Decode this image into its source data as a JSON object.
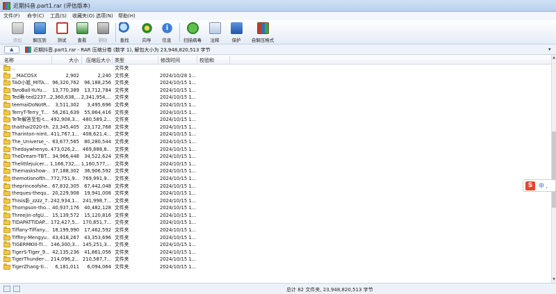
{
  "window": {
    "title": "近期抖音.part1.rar (评估版本)"
  },
  "menu": [
    "文件(F)",
    "命令(C)",
    "工具(S)",
    "收藏夹(O)",
    "选项(N)",
    "帮助(H)"
  ],
  "toolbar": [
    {
      "label": "添加",
      "icon": "add-files-icon",
      "dim": true
    },
    {
      "label": "解压到",
      "icon": "extract-folder-icon"
    },
    {
      "label": "测试",
      "icon": "test-checklist-icon"
    },
    {
      "label": "查看",
      "icon": "view-book-icon"
    },
    {
      "label": "删除",
      "icon": "trash-icon",
      "dim": true
    },
    {
      "label": "查找",
      "icon": "magnifier-icon"
    },
    {
      "label": "向导",
      "icon": "wizard-icon"
    },
    {
      "label": "信息",
      "icon": "info-icon"
    },
    {
      "label": "扫描病毒",
      "icon": "virus-scan-icon"
    },
    {
      "label": "注释",
      "icon": "comment-icon"
    },
    {
      "label": "保护",
      "icon": "shield-icon"
    },
    {
      "label": "自解压格式",
      "icon": "sfx-icon"
    }
  ],
  "address": {
    "path": "近期抖音.part1.rar - RAR 压缩分卷 (数字 1), 解包大小为 23,948,820,513 字节"
  },
  "columns": [
    "名称",
    "大小",
    "压缩后大小",
    "类型",
    "修改时间",
    "校验和"
  ],
  "rows": [
    {
      "name": "..",
      "size": "",
      "packed": "",
      "type": "文件夹",
      "modified": ""
    },
    {
      "name": "__MACOSX",
      "size": "2,902",
      "packed": "2,240",
      "type": "文件夹",
      "modified": "2024/10/28 1..."
    },
    {
      "name": "TAO小姐_MITA...",
      "size": "96,320,762",
      "packed": "96,188,256",
      "type": "文件夹",
      "modified": "2024/10/15 1..."
    },
    {
      "name": "TaroBall-YuYu...",
      "size": "13,770,389",
      "packed": "13,712,784",
      "type": "文件夹",
      "modified": "2024/10/15 1..."
    },
    {
      "name": "Ted啾-ted2237...",
      "size": "2,360,638,...",
      "packed": "2,341,954,...",
      "type": "文件夹",
      "modified": "2024/10/15 1..."
    },
    {
      "name": "teemaiDoNotR...",
      "size": "3,511,302",
      "packed": "3,495,696",
      "type": "文件夹",
      "modified": "2024/10/15 1..."
    },
    {
      "name": "TerryT-Terry_T...",
      "size": "56,261,639",
      "packed": "55,864,416",
      "type": "文件夹",
      "modified": "2024/10/15 1..."
    },
    {
      "name": "TeTe解答至包-t...",
      "size": "492,908,3...",
      "packed": "480,589,2...",
      "type": "文件夹",
      "modified": "2024/10/15 1..."
    },
    {
      "name": "thaithai2020-th...",
      "size": "23,345,405",
      "packed": "23,172,768",
      "type": "文件夹",
      "modified": "2024/10/15 1..."
    },
    {
      "name": "Tharinton-nimt...",
      "size": "411,767,1...",
      "packed": "408,621,4...",
      "type": "文件夹",
      "modified": "2024/10/15 1..."
    },
    {
      "name": "The_Universe_-...",
      "size": "83,677,565",
      "packed": "80,280,544",
      "type": "文件夹",
      "modified": "2024/10/15 1..."
    },
    {
      "name": "Thedaywhenyo...",
      "size": "473,026,2...",
      "packed": "469,888,8...",
      "type": "文件夹",
      "modified": "2024/10/15 1..."
    },
    {
      "name": "TheDream-TBT...",
      "size": "34,966,448",
      "packed": "34,522,624",
      "type": "文件夹",
      "modified": "2024/10/15 1..."
    },
    {
      "name": "Thelittlejuicer...",
      "size": "1,166,732,...",
      "packed": "1,160,577,...",
      "type": "文件夹",
      "modified": "2024/10/15 1..."
    },
    {
      "name": "Themaskshow-...",
      "size": "37,188,302",
      "packed": "36,906,592",
      "type": "文件夹",
      "modified": "2024/10/15 1..."
    },
    {
      "name": "themotionofth...",
      "size": "772,751,9...",
      "packed": "769,991,9...",
      "type": "文件夹",
      "modified": "2024/10/15 1..."
    },
    {
      "name": "theprinceofshe...",
      "size": "67,832,305",
      "packed": "67,442,048",
      "type": "文件夹",
      "modified": "2024/10/15 1..."
    },
    {
      "name": "theques-thequ...",
      "size": "20,229,908",
      "packed": "19,941,008",
      "type": "文件夹",
      "modified": "2024/10/15 1..."
    },
    {
      "name": "Thisis卧_zzzz_7...",
      "size": "242,934,1...",
      "packed": "241,998,7...",
      "type": "文件夹",
      "modified": "2024/10/15 1..."
    },
    {
      "name": "Thompson-tho...",
      "size": "40,937,176",
      "packed": "40,482,128",
      "type": "文件夹",
      "modified": "2024/10/15 1..."
    },
    {
      "name": "Threejin-ofgU...",
      "size": "15,139,572",
      "packed": "15,120,816",
      "type": "文件夹",
      "modified": "2024/10/15 1..."
    },
    {
      "name": "TIDAPATTIDAP...",
      "size": "172,427,5...",
      "packed": "170,851,7...",
      "type": "文件夹",
      "modified": "2024/10/15 1..."
    },
    {
      "name": "Tiffany-Tiffany...",
      "size": "18,199,990",
      "packed": "17,462,592",
      "type": "文件夹",
      "modified": "2024/10/15 1..."
    },
    {
      "name": "Tiffiny-Mengyu...",
      "size": "43,418,267",
      "packed": "43,353,696",
      "type": "文件夹",
      "modified": "2024/10/15 1..."
    },
    {
      "name": "TIGERMKIII-TI...",
      "size": "146,300,3...",
      "packed": "145,251,3...",
      "type": "文件夹",
      "modified": "2024/10/15 1..."
    },
    {
      "name": "TigerS-Tiger_9...",
      "size": "42,135,236",
      "packed": "41,861,056",
      "type": "文件夹",
      "modified": "2024/10/15 1..."
    },
    {
      "name": "TigerThunder-...",
      "size": "214,096,2...",
      "packed": "210,587,7...",
      "type": "文件夹",
      "modified": "2024/10/15 1..."
    },
    {
      "name": "TigerZhang-ti...",
      "size": "6,181,011",
      "packed": "6,094,064",
      "type": "文件夹",
      "modified": "2024/10/15 1..."
    }
  ],
  "status": {
    "text": "总计 82 文件夹, 23,948,820,513 字节"
  },
  "ime": {
    "logo": "S",
    "label": "中 ,"
  }
}
